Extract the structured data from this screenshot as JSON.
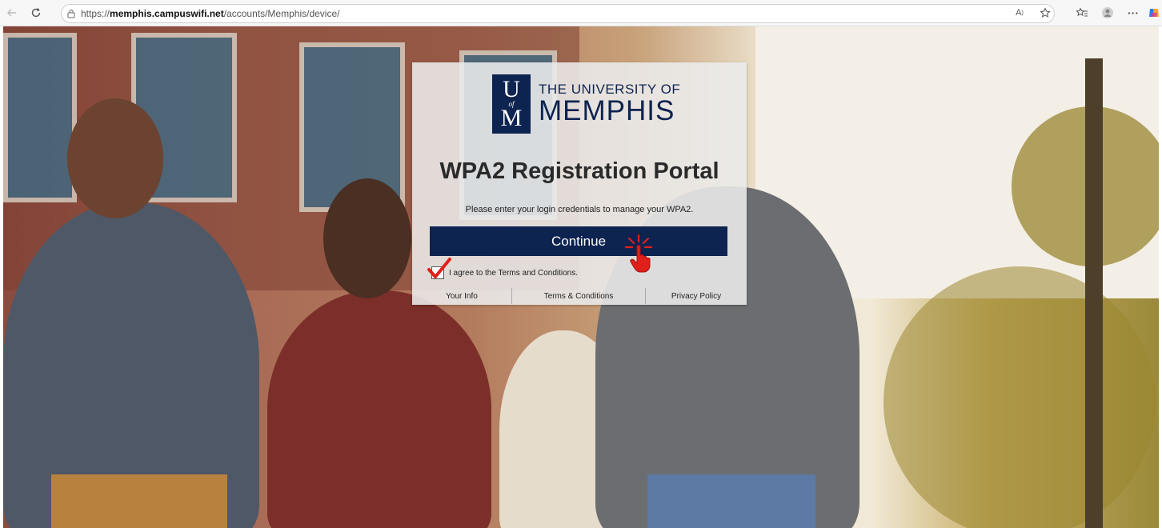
{
  "browser": {
    "url_scheme": "https://",
    "url_host": "memphis.campuswifi.net",
    "url_path": "/accounts/Memphis/device/",
    "back_icon": "back-arrow-icon",
    "refresh_icon": "refresh-icon",
    "read_aloud_icon": "read-aloud-icon",
    "favorite_icon": "star-icon",
    "favorites_icon": "favorites-icon",
    "profile_icon": "profile-icon",
    "more_icon": "more-icon",
    "copilot_icon": "copilot-icon"
  },
  "portal": {
    "logo": {
      "mark_top": "U",
      "mark_middle": "of",
      "mark_bottom": "M",
      "line1": "THE UNIVERSITY OF",
      "line2": "MEMPHIS"
    },
    "title": "WPA2 Registration Portal",
    "subtitle": "Please enter your login credentials to manage your WPA2.",
    "continue_label": "Continue",
    "agree_label": "I agree to the Terms and Conditions.",
    "agree_checked": true,
    "footer_links": {
      "your_info": "Your Info",
      "terms": "Terms & Conditions",
      "privacy": "Privacy Policy"
    },
    "colors": {
      "brand_navy": "#0d2350",
      "check_red": "#e0201a"
    }
  }
}
